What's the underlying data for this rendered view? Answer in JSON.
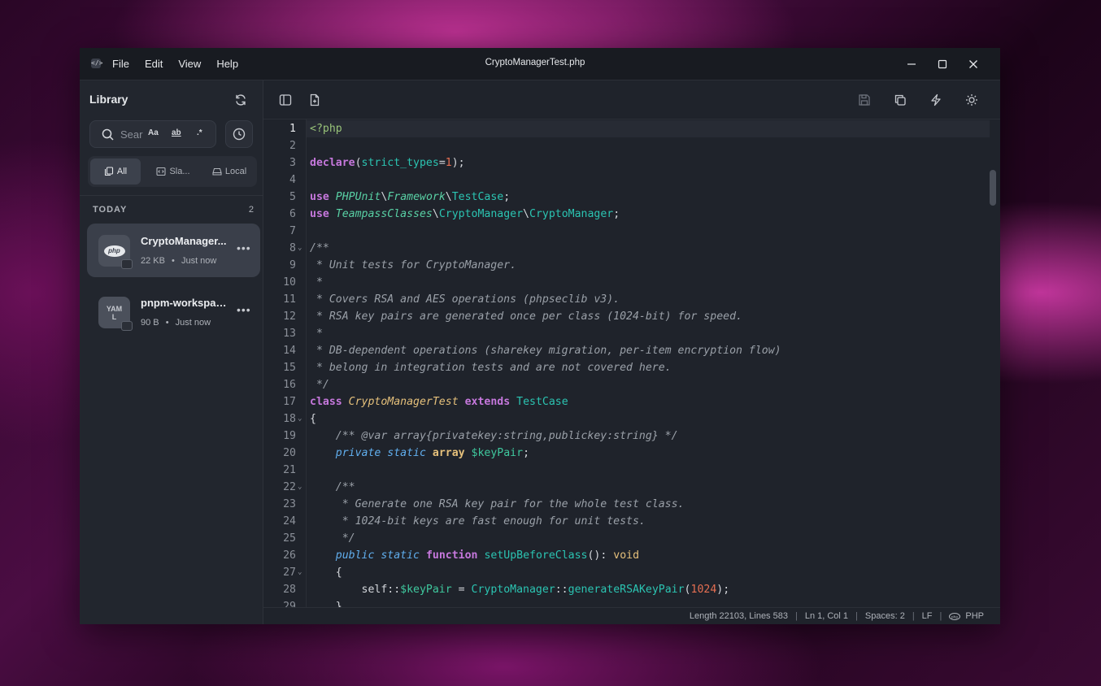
{
  "window": {
    "title": "CryptoManagerTest.php",
    "app_logo_glyph": "</>",
    "menu": [
      "File",
      "Edit",
      "View",
      "Help"
    ]
  },
  "sidebar": {
    "title": "Library",
    "search": {
      "placeholder": "Search",
      "opt_case": "Aa",
      "opt_word": "ab",
      "opt_regex": ".*"
    },
    "filters": [
      {
        "label": "All",
        "active": true
      },
      {
        "label": "Sla...",
        "active": false
      },
      {
        "label": "Local",
        "active": false
      }
    ],
    "section": {
      "label": "TODAY",
      "count": "2"
    },
    "items": [
      {
        "name": "CryptoManager...",
        "size": "22 KB",
        "time": "Just now",
        "icon": "php",
        "selected": true
      },
      {
        "name": "pnpm-workspac...",
        "size": "90 B",
        "time": "Just now",
        "icon": "YAML",
        "selected": false
      }
    ]
  },
  "status": {
    "length": "Length 22103, Lines 583",
    "cursor": "Ln 1, Col 1",
    "spaces": "Spaces: 2",
    "eol": "LF",
    "language": "PHP"
  },
  "code": {
    "lines": [
      "<?php",
      "",
      "declare(strict_types=1);",
      "",
      "use PHPUnit\\Framework\\TestCase;",
      "use TeampassClasses\\CryptoManager\\CryptoManager;",
      "",
      "/**",
      " * Unit tests for CryptoManager.",
      " *",
      " * Covers RSA and AES operations (phpseclib v3).",
      " * RSA key pairs are generated once per class (1024-bit) for speed.",
      " *",
      " * DB-dependent operations (sharekey migration, per-item encryption flow)",
      " * belong in integration tests and are not covered here.",
      " */",
      "class CryptoManagerTest extends TestCase",
      "{",
      "    /** @var array{privatekey:string,publickey:string} */",
      "    private static array $keyPair;",
      "",
      "    /**",
      "     * Generate one RSA key pair for the whole test class.",
      "     * 1024-bit keys are fast enough for unit tests.",
      "     */",
      "    public static function setUpBeforeClass(): void",
      "    {",
      "        self::$keyPair = CryptoManager::generateRSAKeyPair(1024);",
      "    }"
    ],
    "fold_lines": [
      8,
      18,
      22,
      27
    ]
  }
}
